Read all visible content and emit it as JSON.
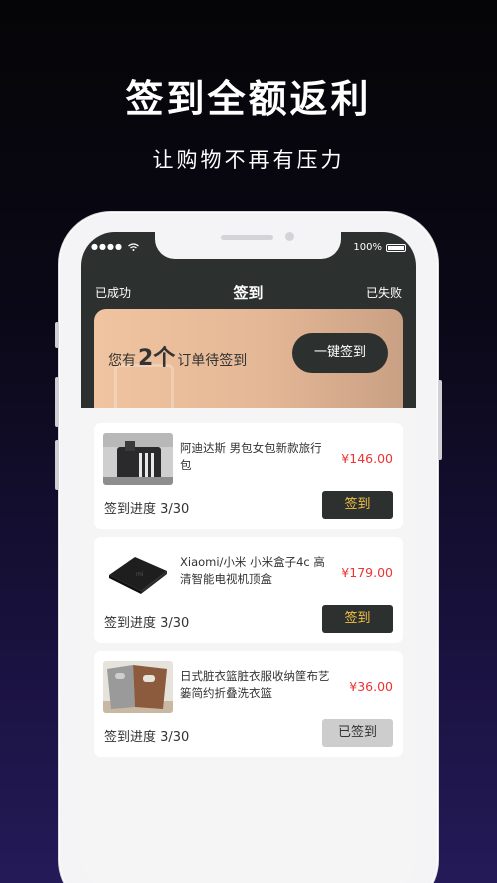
{
  "promo": {
    "headline": "签到全额返利",
    "subline": "让购物不再有压力"
  },
  "status_bar": {
    "signal": "●●●●",
    "battery": "100%"
  },
  "nav": {
    "left": "已成功",
    "title": "签到",
    "right": "已失败"
  },
  "banner": {
    "prefix": "您有",
    "count": "2个",
    "suffix": "订单待签到",
    "button": "一键签到"
  },
  "orders": [
    {
      "name": "阿迪达斯 男包女包新款旅行包",
      "price": "¥146.00",
      "progress": "签到进度 3/30",
      "action": "签到",
      "state": "active",
      "thumb": "bag"
    },
    {
      "name": "Xiaomi/小米 小米盒子4c 高清智能电视机顶盒",
      "price": "¥179.00",
      "progress": "签到进度 3/30",
      "action": "签到",
      "state": "active",
      "thumb": "tvbox"
    },
    {
      "name": "日式脏衣篮脏衣服收纳筐布艺篓简约折叠洗衣篮",
      "price": "¥36.00",
      "progress": "签到进度 3/30",
      "action": "已签到",
      "state": "done",
      "thumb": "basket"
    }
  ],
  "colors": {
    "dark": "#2c302f",
    "accent_gold": "#f3c144",
    "price_red": "#ee3333"
  }
}
